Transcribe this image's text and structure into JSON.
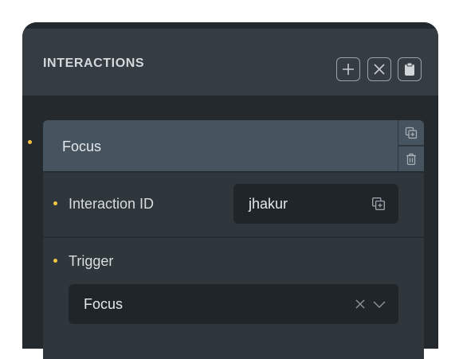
{
  "panel": {
    "title": "INTERACTIONS",
    "actions": [
      {
        "icon": "plus-icon"
      },
      {
        "icon": "close-icon"
      },
      {
        "icon": "clipboard-icon"
      }
    ]
  },
  "interaction": {
    "name": "Focus",
    "side_actions": [
      {
        "icon": "duplicate-icon"
      },
      {
        "icon": "trash-icon"
      }
    ],
    "id_label": "Interaction ID",
    "id_value": "jhakur",
    "trigger_label": "Trigger",
    "trigger_value": "Focus"
  },
  "colors": {
    "accent_dot": "#f5c542",
    "panel_bg": "#2c3338",
    "card_header_bg": "#46545f",
    "field_bg": "#1f2529"
  }
}
